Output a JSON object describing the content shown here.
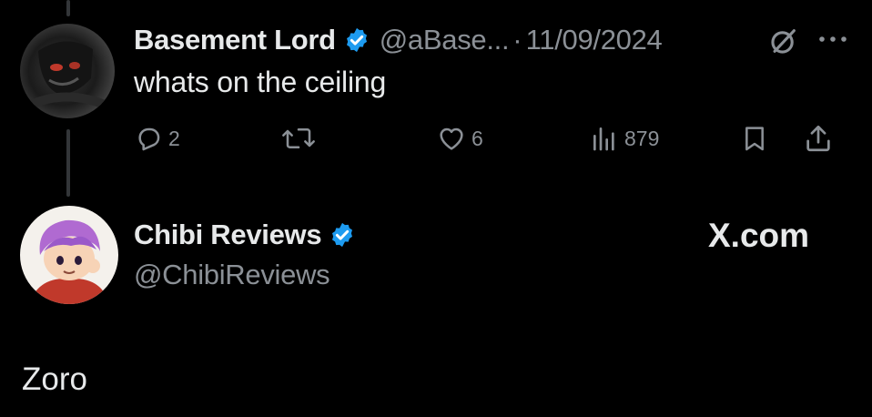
{
  "colors": {
    "background": "#000000",
    "text_primary": "#e7e9ea",
    "text_secondary": "#8b9096",
    "verified_blue": "#1d9bf0",
    "thread_line": "#333639"
  },
  "tweet": {
    "author": {
      "display_name": "Basement Lord",
      "handle": "@aBase...",
      "verified": true,
      "avatar_icon": "dark-skull-avatar"
    },
    "separator": "·",
    "date": "11/09/2024",
    "text": "whats on the ceiling",
    "actions": {
      "reply": {
        "icon": "reply-icon",
        "count": "2"
      },
      "retweet": {
        "icon": "retweet-icon",
        "count": ""
      },
      "like": {
        "icon": "heart-icon",
        "count": "6"
      },
      "views": {
        "icon": "views-icon",
        "count": "879"
      },
      "bookmark": {
        "icon": "bookmark-icon"
      },
      "share": {
        "icon": "share-icon"
      }
    }
  },
  "reply": {
    "author": {
      "display_name": "Chibi Reviews",
      "handle": "@ChibiReviews",
      "verified": true,
      "avatar_icon": "chibi-character-avatar"
    },
    "brand": "X.com",
    "brand_icon": "x-logo-icon",
    "text": "Zoro"
  }
}
